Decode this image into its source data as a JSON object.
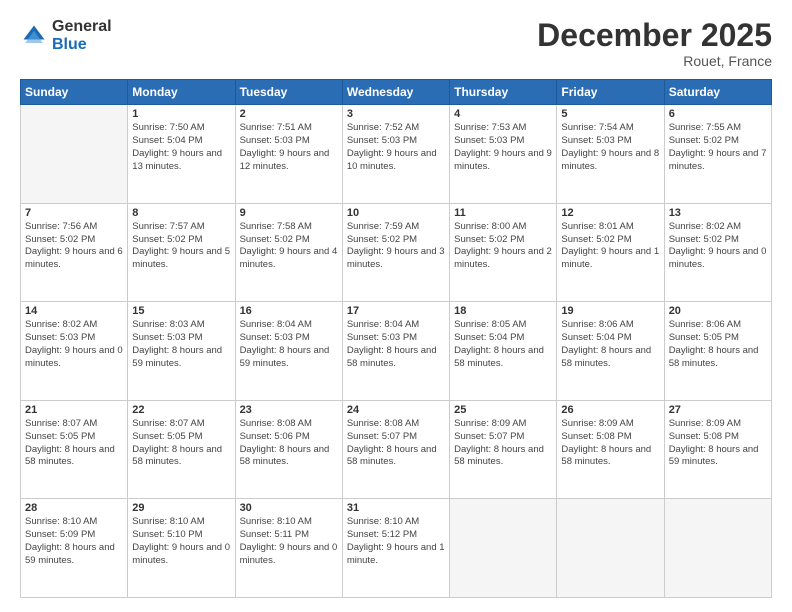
{
  "logo": {
    "general": "General",
    "blue": "Blue"
  },
  "header": {
    "month": "December 2025",
    "location": "Rouet, France"
  },
  "weekdays": [
    "Sunday",
    "Monday",
    "Tuesday",
    "Wednesday",
    "Thursday",
    "Friday",
    "Saturday"
  ],
  "weeks": [
    [
      {
        "day": "",
        "info": ""
      },
      {
        "day": "1",
        "info": "Sunrise: 7:50 AM\nSunset: 5:04 PM\nDaylight: 9 hours\nand 13 minutes."
      },
      {
        "day": "2",
        "info": "Sunrise: 7:51 AM\nSunset: 5:03 PM\nDaylight: 9 hours\nand 12 minutes."
      },
      {
        "day": "3",
        "info": "Sunrise: 7:52 AM\nSunset: 5:03 PM\nDaylight: 9 hours\nand 10 minutes."
      },
      {
        "day": "4",
        "info": "Sunrise: 7:53 AM\nSunset: 5:03 PM\nDaylight: 9 hours\nand 9 minutes."
      },
      {
        "day": "5",
        "info": "Sunrise: 7:54 AM\nSunset: 5:03 PM\nDaylight: 9 hours\nand 8 minutes."
      },
      {
        "day": "6",
        "info": "Sunrise: 7:55 AM\nSunset: 5:02 PM\nDaylight: 9 hours\nand 7 minutes."
      }
    ],
    [
      {
        "day": "7",
        "info": "Sunrise: 7:56 AM\nSunset: 5:02 PM\nDaylight: 9 hours\nand 6 minutes."
      },
      {
        "day": "8",
        "info": "Sunrise: 7:57 AM\nSunset: 5:02 PM\nDaylight: 9 hours\nand 5 minutes."
      },
      {
        "day": "9",
        "info": "Sunrise: 7:58 AM\nSunset: 5:02 PM\nDaylight: 9 hours\nand 4 minutes."
      },
      {
        "day": "10",
        "info": "Sunrise: 7:59 AM\nSunset: 5:02 PM\nDaylight: 9 hours\nand 3 minutes."
      },
      {
        "day": "11",
        "info": "Sunrise: 8:00 AM\nSunset: 5:02 PM\nDaylight: 9 hours\nand 2 minutes."
      },
      {
        "day": "12",
        "info": "Sunrise: 8:01 AM\nSunset: 5:02 PM\nDaylight: 9 hours\nand 1 minute."
      },
      {
        "day": "13",
        "info": "Sunrise: 8:02 AM\nSunset: 5:02 PM\nDaylight: 9 hours\nand 0 minutes."
      }
    ],
    [
      {
        "day": "14",
        "info": "Sunrise: 8:02 AM\nSunset: 5:03 PM\nDaylight: 9 hours\nand 0 minutes."
      },
      {
        "day": "15",
        "info": "Sunrise: 8:03 AM\nSunset: 5:03 PM\nDaylight: 8 hours\nand 59 minutes."
      },
      {
        "day": "16",
        "info": "Sunrise: 8:04 AM\nSunset: 5:03 PM\nDaylight: 8 hours\nand 59 minutes."
      },
      {
        "day": "17",
        "info": "Sunrise: 8:04 AM\nSunset: 5:03 PM\nDaylight: 8 hours\nand 58 minutes."
      },
      {
        "day": "18",
        "info": "Sunrise: 8:05 AM\nSunset: 5:04 PM\nDaylight: 8 hours\nand 58 minutes."
      },
      {
        "day": "19",
        "info": "Sunrise: 8:06 AM\nSunset: 5:04 PM\nDaylight: 8 hours\nand 58 minutes."
      },
      {
        "day": "20",
        "info": "Sunrise: 8:06 AM\nSunset: 5:05 PM\nDaylight: 8 hours\nand 58 minutes."
      }
    ],
    [
      {
        "day": "21",
        "info": "Sunrise: 8:07 AM\nSunset: 5:05 PM\nDaylight: 8 hours\nand 58 minutes."
      },
      {
        "day": "22",
        "info": "Sunrise: 8:07 AM\nSunset: 5:05 PM\nDaylight: 8 hours\nand 58 minutes."
      },
      {
        "day": "23",
        "info": "Sunrise: 8:08 AM\nSunset: 5:06 PM\nDaylight: 8 hours\nand 58 minutes."
      },
      {
        "day": "24",
        "info": "Sunrise: 8:08 AM\nSunset: 5:07 PM\nDaylight: 8 hours\nand 58 minutes."
      },
      {
        "day": "25",
        "info": "Sunrise: 8:09 AM\nSunset: 5:07 PM\nDaylight: 8 hours\nand 58 minutes."
      },
      {
        "day": "26",
        "info": "Sunrise: 8:09 AM\nSunset: 5:08 PM\nDaylight: 8 hours\nand 58 minutes."
      },
      {
        "day": "27",
        "info": "Sunrise: 8:09 AM\nSunset: 5:08 PM\nDaylight: 8 hours\nand 59 minutes."
      }
    ],
    [
      {
        "day": "28",
        "info": "Sunrise: 8:10 AM\nSunset: 5:09 PM\nDaylight: 8 hours\nand 59 minutes."
      },
      {
        "day": "29",
        "info": "Sunrise: 8:10 AM\nSunset: 5:10 PM\nDaylight: 9 hours\nand 0 minutes."
      },
      {
        "day": "30",
        "info": "Sunrise: 8:10 AM\nSunset: 5:11 PM\nDaylight: 9 hours\nand 0 minutes."
      },
      {
        "day": "31",
        "info": "Sunrise: 8:10 AM\nSunset: 5:12 PM\nDaylight: 9 hours\nand 1 minute."
      },
      {
        "day": "",
        "info": ""
      },
      {
        "day": "",
        "info": ""
      },
      {
        "day": "",
        "info": ""
      }
    ]
  ]
}
